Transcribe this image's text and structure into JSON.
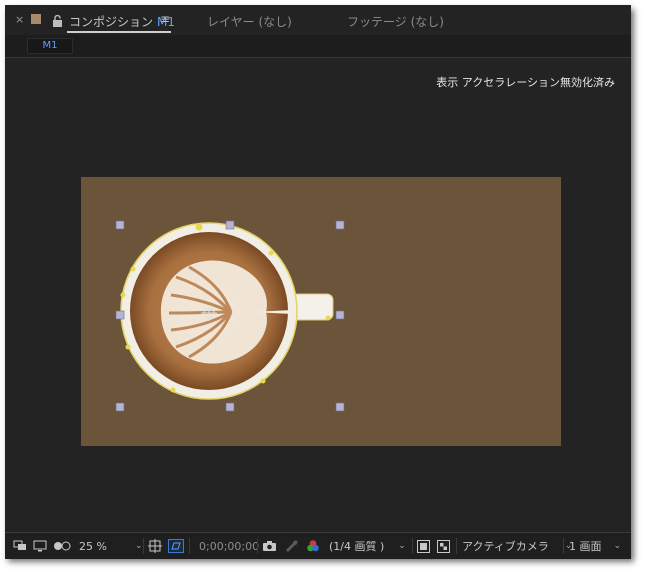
{
  "tabs": {
    "close_glyph": "×",
    "swatch_color": "#a78a6b",
    "lock_icon": "unlock-icon",
    "composition_label": "コンポジション",
    "composition_name": "M1",
    "menu_glyph": "≡",
    "layer_tab": "レイヤー (なし)",
    "footage_tab": "フッテージ (なし)"
  },
  "subbar": {
    "comp_chip": "M1"
  },
  "viewer": {
    "accel_note": "表示 アクセラレーション無効化済み",
    "comp_bg_color": "#6b553a"
  },
  "toolbar": {
    "zoom": "25 %",
    "timecode": "0;00;00;00",
    "resolution": "(1/4 画質 )",
    "camera": "アクティブカメラ",
    "views": "1 画面"
  }
}
